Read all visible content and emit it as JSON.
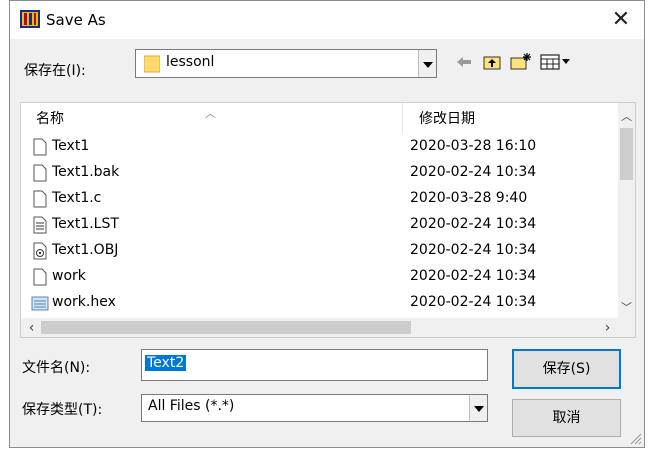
{
  "window": {
    "title": "Save As",
    "app_icon": "visual-studio-icon",
    "close_icon": "close-icon"
  },
  "location": {
    "label": "保存在(I):",
    "value": "lessonl",
    "folder_icon": "folder-icon"
  },
  "toolbar": {
    "icons": [
      "back-arrow-icon",
      "up-folder-icon",
      "new-folder-icon",
      "view-menu-icon"
    ]
  },
  "file_list": {
    "columns": {
      "name": "名称",
      "date": "修改日期"
    },
    "rows": [
      {
        "name": "Text1",
        "date": "2020-03-28 16:10",
        "icon": "blank-file-icon"
      },
      {
        "name": "Text1.bak",
        "date": "2020-02-24 10:34",
        "icon": "blank-file-icon"
      },
      {
        "name": "Text1.c",
        "date": "2020-03-28 9:40",
        "icon": "blank-file-icon"
      },
      {
        "name": "Text1.LST",
        "date": "2020-02-24 10:34",
        "icon": "text-file-icon"
      },
      {
        "name": "Text1.OBJ",
        "date": "2020-02-24 10:34",
        "icon": "object-file-icon"
      },
      {
        "name": "work",
        "date": "2020-02-24 10:34",
        "icon": "blank-file-icon"
      },
      {
        "name": "work.hex",
        "date": "2020-02-24 10:34",
        "icon": "hex-file-icon"
      }
    ]
  },
  "filename": {
    "label": "文件名(N):",
    "value": "Text2"
  },
  "filetype": {
    "label": "保存类型(T):",
    "value": "All Files (*.*)"
  },
  "buttons": {
    "save": "保存(S)",
    "cancel": "取消"
  },
  "colors": {
    "selection": "#0078d7",
    "dialog_bg": "#f0f0f0"
  }
}
